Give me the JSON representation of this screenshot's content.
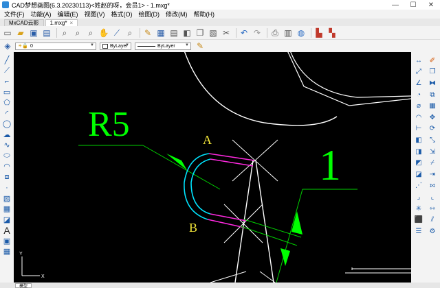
{
  "window": {
    "title": "CAD梦想画图(6.3.20230113)<姓赵的呀，会员1> - 1.mxg*",
    "controls": {
      "minimize": "—",
      "maximize": "☐",
      "close": "✕"
    }
  },
  "menu": [
    "文件(F)",
    "功能(A)",
    "编辑(E)",
    "视图(V)",
    "格式(O)",
    "绘图(D)",
    "修改(M)",
    "帮助(H)"
  ],
  "tabs": [
    {
      "label": "MxCAD云影"
    },
    {
      "label": "1.mxg*",
      "close": "×"
    }
  ],
  "properties": {
    "layer": "0",
    "color": "ByLayer",
    "linetype": "ByLayer"
  },
  "bottom_tabs": [
    "模型"
  ],
  "drawing": {
    "radius_label": "R5",
    "point_a": "A",
    "point_b": "B",
    "dimension_value": "1",
    "ucs_y": "Y",
    "ucs_x": "X"
  },
  "colors": {
    "canvas_bg": "#000000",
    "dim_green": "#00d000",
    "dim_text_green": "#00ff00",
    "arc_cyan": "#00e5ff",
    "line_magenta": "#ff29e0",
    "label_yellow": "#f5e83a",
    "geometry_white": "#ffffff"
  }
}
